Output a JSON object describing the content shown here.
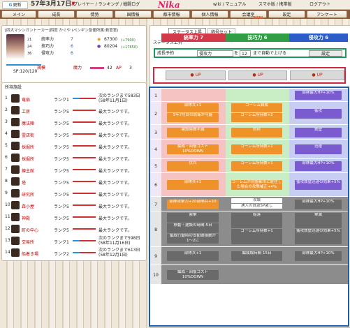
{
  "topbar": {
    "refresh_label": "更新",
    "date": "57年3月17日",
    "era_tag": "夏",
    "links": [
      "プレイヤー / ランキング / 戦闘ログ",
      "wiki / マニュアル",
      "スマホ版 / 携帯版",
      "ログアウト"
    ],
    "logo": "Nika"
  },
  "nav": [
    "メイン",
    "成長",
    "情勢",
    "国情報",
    "都市情報",
    "個人情報",
    "会議室",
    "設定",
    "アンケート"
  ],
  "new_tag": "NEW",
  "player": {
    "title": "[四大マシンガントーカー]四窓 かぐや (ペンギン急便所属:救官官)",
    "hp": "SP:120/120",
    "stats": [
      {
        "label": "統率力",
        "value": "7",
        "icon_text": "21"
      },
      {
        "label": "技巧力",
        "value": "6",
        "icon_text": "24"
      },
      {
        "label": "侵攻力",
        "value": "6",
        "icon_text": "36"
      }
    ],
    "gold": "67300",
    "gold_delta": "(+7900)",
    "food": "80204",
    "food_delta": "(+17650)",
    "rank_label": "規模",
    "power_label": "魔力",
    "power_value": "42",
    "ap_label": "AP",
    "ap_value": "3"
  },
  "production": {
    "title": "所持施設",
    "rows": [
      {
        "idx": "1",
        "name": "竜扇",
        "rank": "ランク1",
        "msg": "次のランクまで583日",
        "msg2": "(58年11月1日)"
      },
      {
        "idx": "2",
        "name": "工房",
        "rank": "ランク5",
        "msg": "最大ランクです。",
        "msg2": ""
      },
      {
        "idx": "3",
        "name": "魔法陣",
        "rank": "ランク5",
        "msg": "最大ランクです。",
        "msg2": ""
      },
      {
        "idx": "4",
        "name": "霊店街",
        "rank": "ランク5",
        "msg": "最大ランクです。",
        "msg2": ""
      },
      {
        "idx": "5",
        "name": "採掘所",
        "rank": "ランク5",
        "msg": "最大ランクです。",
        "msg2": ""
      },
      {
        "idx": "6",
        "name": "採掘所",
        "rank": "ランク5",
        "msg": "最大ランクです。",
        "msg2": ""
      },
      {
        "idx": "7",
        "name": "錬主館",
        "rank": "ランク5",
        "msg": "最大ランクです。",
        "msg2": ""
      },
      {
        "idx": "8",
        "name": "塔",
        "rank": "ランク5",
        "msg": "最大ランクです。",
        "msg2": ""
      },
      {
        "idx": "9",
        "name": "研究所",
        "rank": "ランク5",
        "msg": "最大ランクです。",
        "msg2": ""
      },
      {
        "idx": "10",
        "name": "森小屋",
        "rank": "ランク5",
        "msg": "最大ランクです。",
        "msg2": ""
      },
      {
        "idx": "11",
        "name": "神殿",
        "rank": "ランク5",
        "msg": "最大ランクです。",
        "msg2": ""
      },
      {
        "idx": "12",
        "name": "町の中心",
        "rank": "ランク5",
        "msg": "最大ランクです。",
        "msg2": ""
      },
      {
        "idx": "13",
        "name": "交易所",
        "rank": "ランク1",
        "msg": "次のランクまで598日",
        "msg2": "(58年11月16日)"
      },
      {
        "idx": "14",
        "name": "船着き場",
        "rank": "ランク2",
        "msg": "次のランクまで613日",
        "msg2": "(58年12月1日)"
      }
    ]
  },
  "main": {
    "tabs": [
      "ステータス上昇",
      "称号セット"
    ],
    "section_title": "ステータス上昇",
    "reserve_label": "成長予約",
    "select_value": "侵攻力",
    "level_value": "12",
    "auto_text": "まで自動で上げる",
    "set_button": "設定",
    "columns": [
      {
        "name": "統率力",
        "value": "7",
        "color": "#d23a4a"
      },
      {
        "name": "技巧力",
        "value": "6",
        "color": "#2f9e44"
      },
      {
        "name": "侵攻力",
        "value": "6",
        "color": "#2b5cc7"
      }
    ],
    "up_label": "UP",
    "levels": [
      {
        "lv": "1",
        "c1": [],
        "c2": [],
        "c3": [
          [
            "部隊最大HP+10%",
            "p"
          ]
        ]
      },
      {
        "lv": "2",
        "c1": [
          [
            "部隊兵+1",
            "o"
          ],
          [
            "5年7月目の防衛が可能",
            "o"
          ]
        ],
        "c2": [
          [
            "ゴーレム鋳成",
            "o"
          ],
          [
            "ゴーレム所持数+2",
            "o"
          ]
        ],
        "c3": [
          [
            "猛攻",
            "p"
          ]
        ]
      },
      {
        "lv": "3",
        "c1": [
          [
            "建設時間半減",
            "o"
          ]
        ],
        "c2": [
          [
            "豹砕",
            "o"
          ]
        ],
        "c3": [
          [
            "鉄壁",
            "p"
          ]
        ]
      },
      {
        "lv": "4",
        "c1": [
          [
            "編成・回復コスト10%DOWN",
            "o"
          ]
        ],
        "c2": [
          [
            "ゴーレム所持数+1",
            "o"
          ]
        ],
        "c3": [
          [
            "迅速",
            "p"
          ]
        ]
      },
      {
        "lv": "5",
        "c1": [
          [
            "伏兵",
            "o"
          ]
        ],
        "c2": [
          [
            "ゴーレム所持数+1",
            "o"
          ]
        ],
        "c3": [
          [
            "部隊最大HP+10%",
            "p"
          ]
        ]
      },
      {
        "lv": "6",
        "c1": [
          [
            "部隊兵+1",
            "o"
          ]
        ],
        "c2": [
          [
            "ゴーレムが同盟都市に駐在した場合の攻撃補正+4%",
            "o"
          ]
        ],
        "c3": [
          [
            "猛攻鉄壁迅速の効果+5%",
            "p"
          ]
        ]
      },
      {
        "lv": "7",
        "c1": [
          [
            "部隊攻撃力+20部隊兵+10",
            "o"
          ]
        ],
        "c2": [
          [
            "攻城",
            "gr"
          ],
          [
            "湧入の資源SP激し",
            "gr"
          ]
        ],
        "c3": [
          [
            "部隊最大HP+10%",
            "g"
          ]
        ]
      },
      {
        "lv": "8",
        "c1": [
          [
            "索撃",
            "g"
          ],
          [
            "移動・建設の時間-5日",
            "g"
          ],
          [
            "編成行動時の支配破損数が1〜2に",
            "g"
          ]
        ],
        "c2": [
          [
            "陥落",
            "g"
          ],
          [
            "ゴーレム所持数+1",
            "g"
          ]
        ],
        "c3": [
          [
            "撃滅",
            "g"
          ],
          [
            "猛攻鉄壁迅速の効果+5%",
            "g"
          ]
        ]
      },
      {
        "lv": "9",
        "c1": [
          [
            "部隊兵+1",
            "g"
          ]
        ],
        "c2": [
          [
            "編成成時間-15日",
            "g"
          ]
        ],
        "c3": [
          [
            "部隊最大HP+10%",
            "g"
          ]
        ]
      },
      {
        "lv": "10",
        "c1": [
          [
            "編成・回復コスト10%DOWN",
            "g"
          ]
        ],
        "c2": [],
        "c3": []
      }
    ]
  }
}
